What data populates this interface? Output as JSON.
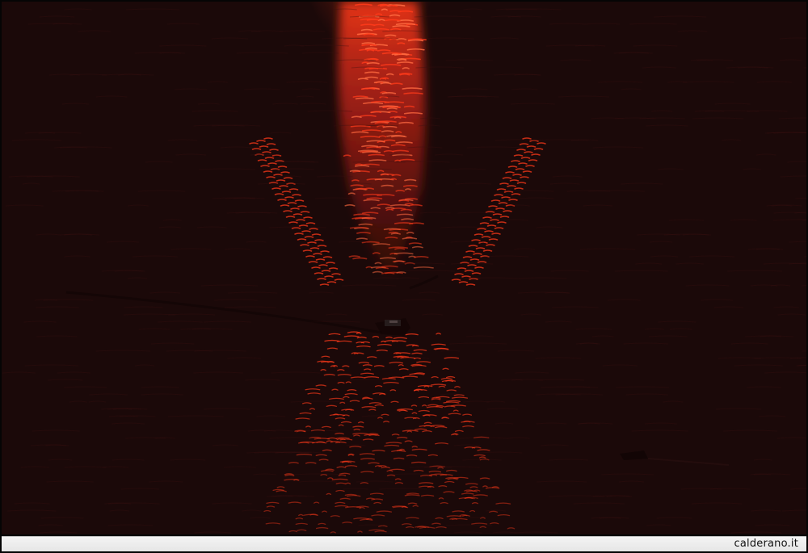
{
  "photo": {
    "scene": "boat-wake-sunset-reflection",
    "colors": {
      "water_dark": "#1b0909",
      "reflection": "#ff3a1a",
      "reflection_hot": "#ff6a40"
    }
  },
  "watermark": {
    "text": "calderano.it"
  }
}
